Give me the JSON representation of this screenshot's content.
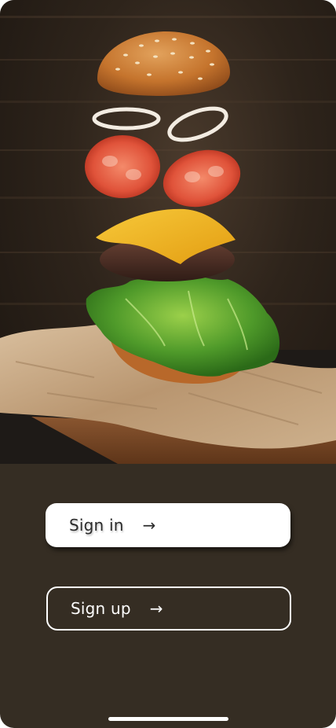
{
  "hero": {
    "image_name": "floating-burger-photo",
    "colors": {
      "background": "#2e241b",
      "bun": "#c9782e",
      "cheese": "#f2b51d",
      "patty": "#4b2e24",
      "tomato": "#e0533a",
      "lettuce": "#4f9a2a",
      "paper": "#c8a987",
      "board": "#7a4a26"
    }
  },
  "actions": {
    "sign_in_label": "Sign in",
    "sign_up_label": "Sign up",
    "arrow_glyph": "→"
  },
  "theme": {
    "panel_bg": "#352d23",
    "primary_button_bg": "#ffffff",
    "outline_button_border": "#ffffff"
  }
}
